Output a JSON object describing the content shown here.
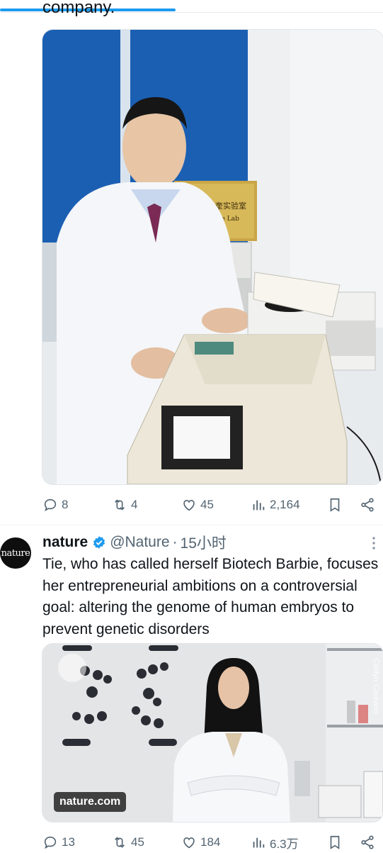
{
  "prev_tweet": {
    "tail_text": "company.",
    "actions": {
      "replies": "8",
      "reposts": "4",
      "likes": "45",
      "views": "2,164"
    }
  },
  "tweet": {
    "avatar_text": "nature",
    "name": "nature",
    "handle": "@Nature",
    "separator": "·",
    "time": "15小时",
    "text": "Tie, who has called herself Biotech Barbie, focuses her entrepreneurial ambitions on a controversial goal: altering the genome of human embryos to prevent genetic disorders",
    "card": {
      "domain": "nature.com",
      "photo_credit": "Caitlyn Caurano"
    },
    "actions": {
      "replies": "13",
      "reposts": "45",
      "likes": "184",
      "views": "6.3万"
    }
  },
  "lab_sign": {
    "line1": "北京贺建奎实验室",
    "line2": "Jiankui He Lab"
  },
  "colors": {
    "accent": "#1d9bf0",
    "muted": "#536471",
    "text": "#0f1419"
  }
}
